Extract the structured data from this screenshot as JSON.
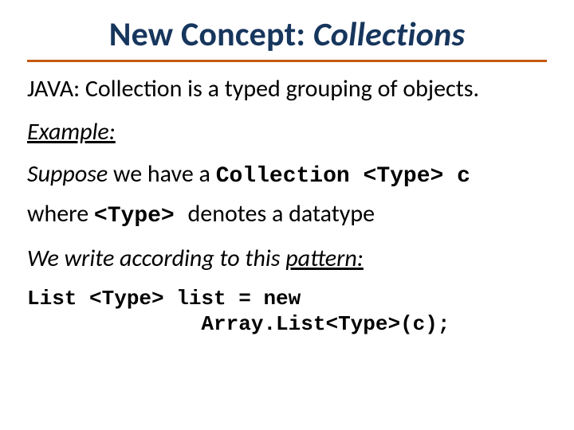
{
  "title": {
    "prefix": "New Concept: ",
    "emphasis": "Collections"
  },
  "definition": "JAVA: Collection is a typed grouping of objects.",
  "example_label": "Example:",
  "suppose": {
    "lead": "Suppose",
    "rest": " we have a ",
    "code": "Collection <Type> c"
  },
  "where": {
    "lead": "where ",
    "code": " <Type> ",
    "rest": "denotes a datatype"
  },
  "pattern": {
    "lead": "We write according to this ",
    "underlined": "pattern:"
  },
  "code_block": "List <Type> list = new\n              Array.List<Type>(c);"
}
